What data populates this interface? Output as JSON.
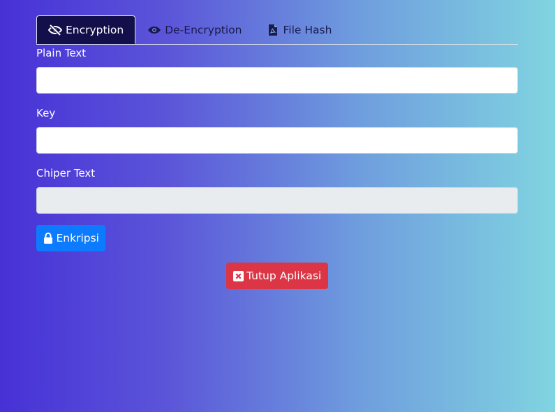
{
  "tabs": [
    {
      "label": "Encryption",
      "icon": "eye-slash-icon",
      "active": true
    },
    {
      "label": "De-Encryption",
      "icon": "eye-icon",
      "active": false
    },
    {
      "label": "File Hash",
      "icon": "file-pdf-icon",
      "active": false
    }
  ],
  "form": {
    "plain_text_label": "Plain Text",
    "plain_text_value": "",
    "key_label": "Key",
    "key_value": "",
    "cipher_text_label": "Chiper Text",
    "cipher_text_value": ""
  },
  "buttons": {
    "encrypt_label": "Enkripsi",
    "close_label": "Tutup Aplikasi"
  },
  "colors": {
    "primary": "#0d7bff",
    "danger": "#dc3545",
    "active_tab": "#130f4a"
  }
}
